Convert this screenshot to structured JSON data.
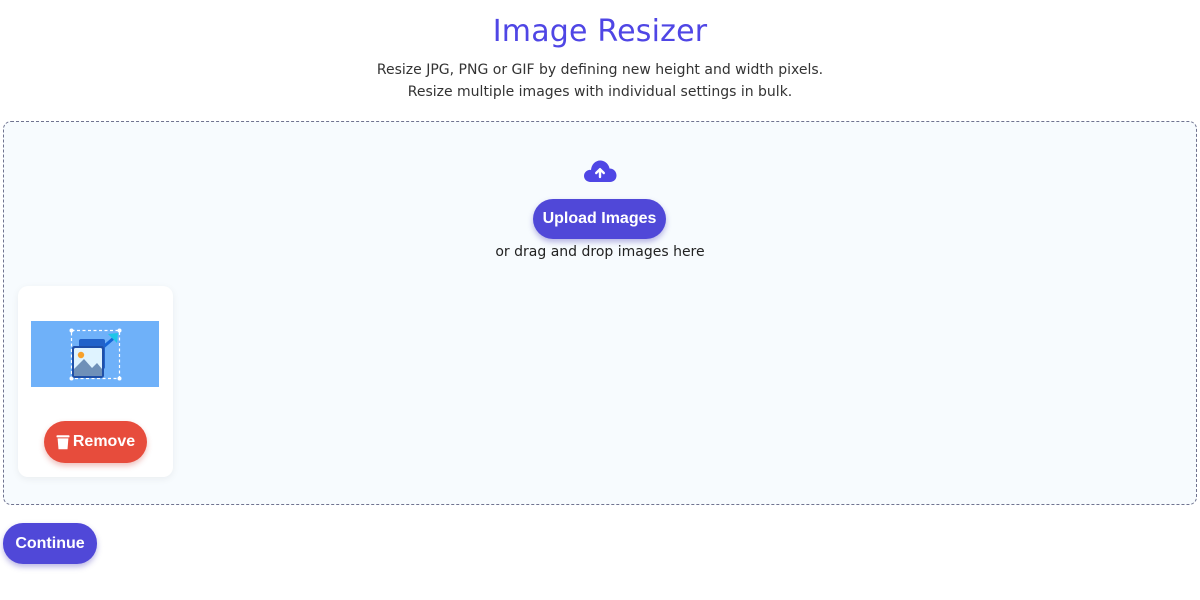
{
  "header": {
    "title": "Image Resizer",
    "subtitle_line1": "Resize JPG, PNG or GIF by defining new height and width pixels.",
    "subtitle_line2": "Resize multiple images with individual settings in bulk."
  },
  "dropzone": {
    "icon": "cloud-upload-icon",
    "upload_label": "Upload Images",
    "drag_text": "or drag and drop images here"
  },
  "uploaded_items": [
    {
      "thumbnail_icon": "image-resize-thumbnail",
      "remove_label": "Remove",
      "remove_icon": "trash-icon"
    }
  ],
  "footer": {
    "continue_label": "Continue"
  },
  "colors": {
    "accent": "#5048d8",
    "title": "#4f46e5",
    "danger": "#e74c3c",
    "dropzone_bg": "#f7fbfe",
    "thumbnail_bg": "#6fb1f9"
  }
}
